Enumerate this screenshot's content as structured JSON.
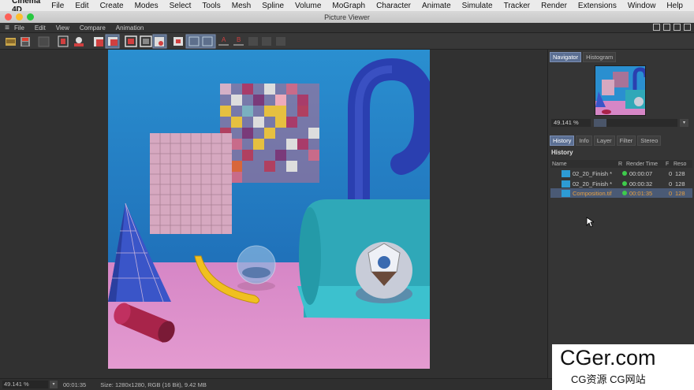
{
  "mac_menu": {
    "app": "Cinema 4D",
    "items": [
      "File",
      "Edit",
      "Create",
      "Modes",
      "Select",
      "Tools",
      "Mesh",
      "Spline",
      "Volume",
      "MoGraph",
      "Character",
      "Animate",
      "Simulate",
      "Tracker",
      "Render",
      "Extensions",
      "Window",
      "Help"
    ]
  },
  "window": {
    "title": "Picture Viewer"
  },
  "pv_menu": {
    "items": [
      "File",
      "Edit",
      "View",
      "Compare",
      "Animation"
    ]
  },
  "navigator": {
    "tabs": [
      "Navigator",
      "Histogram"
    ],
    "zoom": "49.141 %",
    "zoom_fraction": 0.15
  },
  "history_panel": {
    "tabs": [
      "History",
      "Info",
      "Layer",
      "Filter",
      "Stereo"
    ],
    "title": "History",
    "columns": [
      "Name",
      "R",
      "Render Time",
      "F",
      "Reso"
    ],
    "rows": [
      {
        "name": "02_20_Finish *",
        "time": "00:00:07",
        "f": "0",
        "res": "128",
        "status_color": "#3ecb4c"
      },
      {
        "name": "02_20_Finish *",
        "time": "00:00:32",
        "f": "0",
        "res": "128",
        "status_color": "#3ecb4c"
      },
      {
        "name": "Composition.tif",
        "time": "00:01:35",
        "f": "0",
        "res": "128",
        "status_color": "#3ecb4c"
      }
    ]
  },
  "status": {
    "zoom": "49.141 %",
    "time": "00:01:35",
    "size": "Size: 1280x1280, RGB (16 Bit), 9.42 MB"
  },
  "watermark": {
    "big": "CGer.com",
    "small": "CG资源 CG网站"
  },
  "colors": {
    "accent": "#5b6f93",
    "render_ok": "#3ecb4c",
    "selected_text": "#e8a040"
  }
}
